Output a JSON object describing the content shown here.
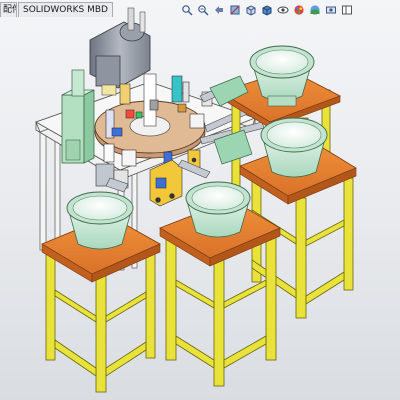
{
  "tabs": [
    {
      "label": "配件"
    },
    {
      "label": "SOLIDWORKS MBD"
    }
  ],
  "view_toolbar": [
    {
      "icon": "zoom-to-fit-icon"
    },
    {
      "icon": "zoom-to-area-icon"
    },
    {
      "icon": "previous-view-icon"
    },
    {
      "icon": "section-view-icon"
    },
    {
      "icon": "view-orientation-icon"
    },
    {
      "icon": "display-style-icon"
    },
    {
      "icon": "hide-show-items-icon"
    },
    {
      "icon": "edit-appearance-icon"
    },
    {
      "icon": "apply-scene-icon"
    },
    {
      "icon": "view-settings-icon"
    },
    {
      "icon": "display-pane-icon"
    }
  ],
  "colors": {
    "stand_frame": "#e8e23a",
    "stand_top": "#e8842c",
    "bowl": "#c9e8d6",
    "table": "#f1f1f1",
    "motor": "#8f95a0",
    "cabinet": "#b3e0c0"
  }
}
